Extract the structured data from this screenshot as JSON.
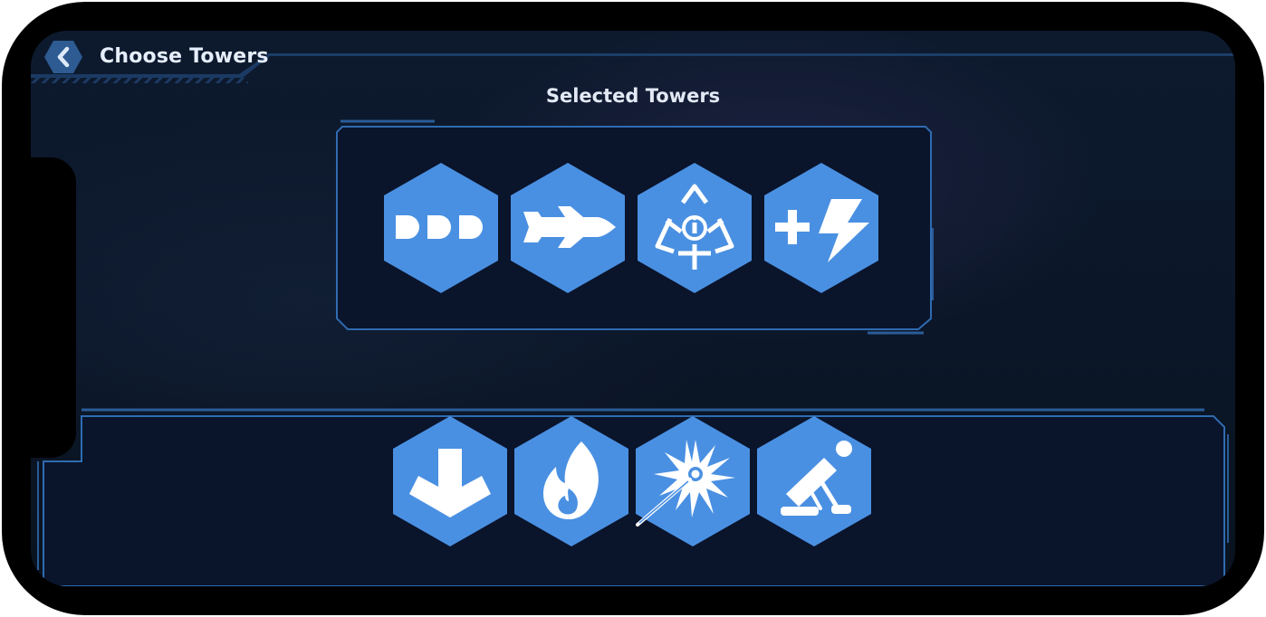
{
  "header": {
    "title": "Choose Towers",
    "back_icon": "chevron-left-icon"
  },
  "selected": {
    "title": "Selected Towers",
    "towers": [
      {
        "icon": "triple-bullet-icon"
      },
      {
        "icon": "missile-icon"
      },
      {
        "icon": "radiation-icon"
      },
      {
        "icon": "plus-lightning-icon"
      }
    ]
  },
  "available": {
    "towers": [
      {
        "icon": "down-arrow-icon"
      },
      {
        "icon": "flame-icon"
      },
      {
        "icon": "laser-burst-icon"
      },
      {
        "icon": "mortar-icon"
      }
    ]
  },
  "colors": {
    "accent": "#4a90e2",
    "panel_fill": "#0a142b",
    "panel_border": "#2f6bb0",
    "background": "#0c1728",
    "frame": "#000000"
  }
}
